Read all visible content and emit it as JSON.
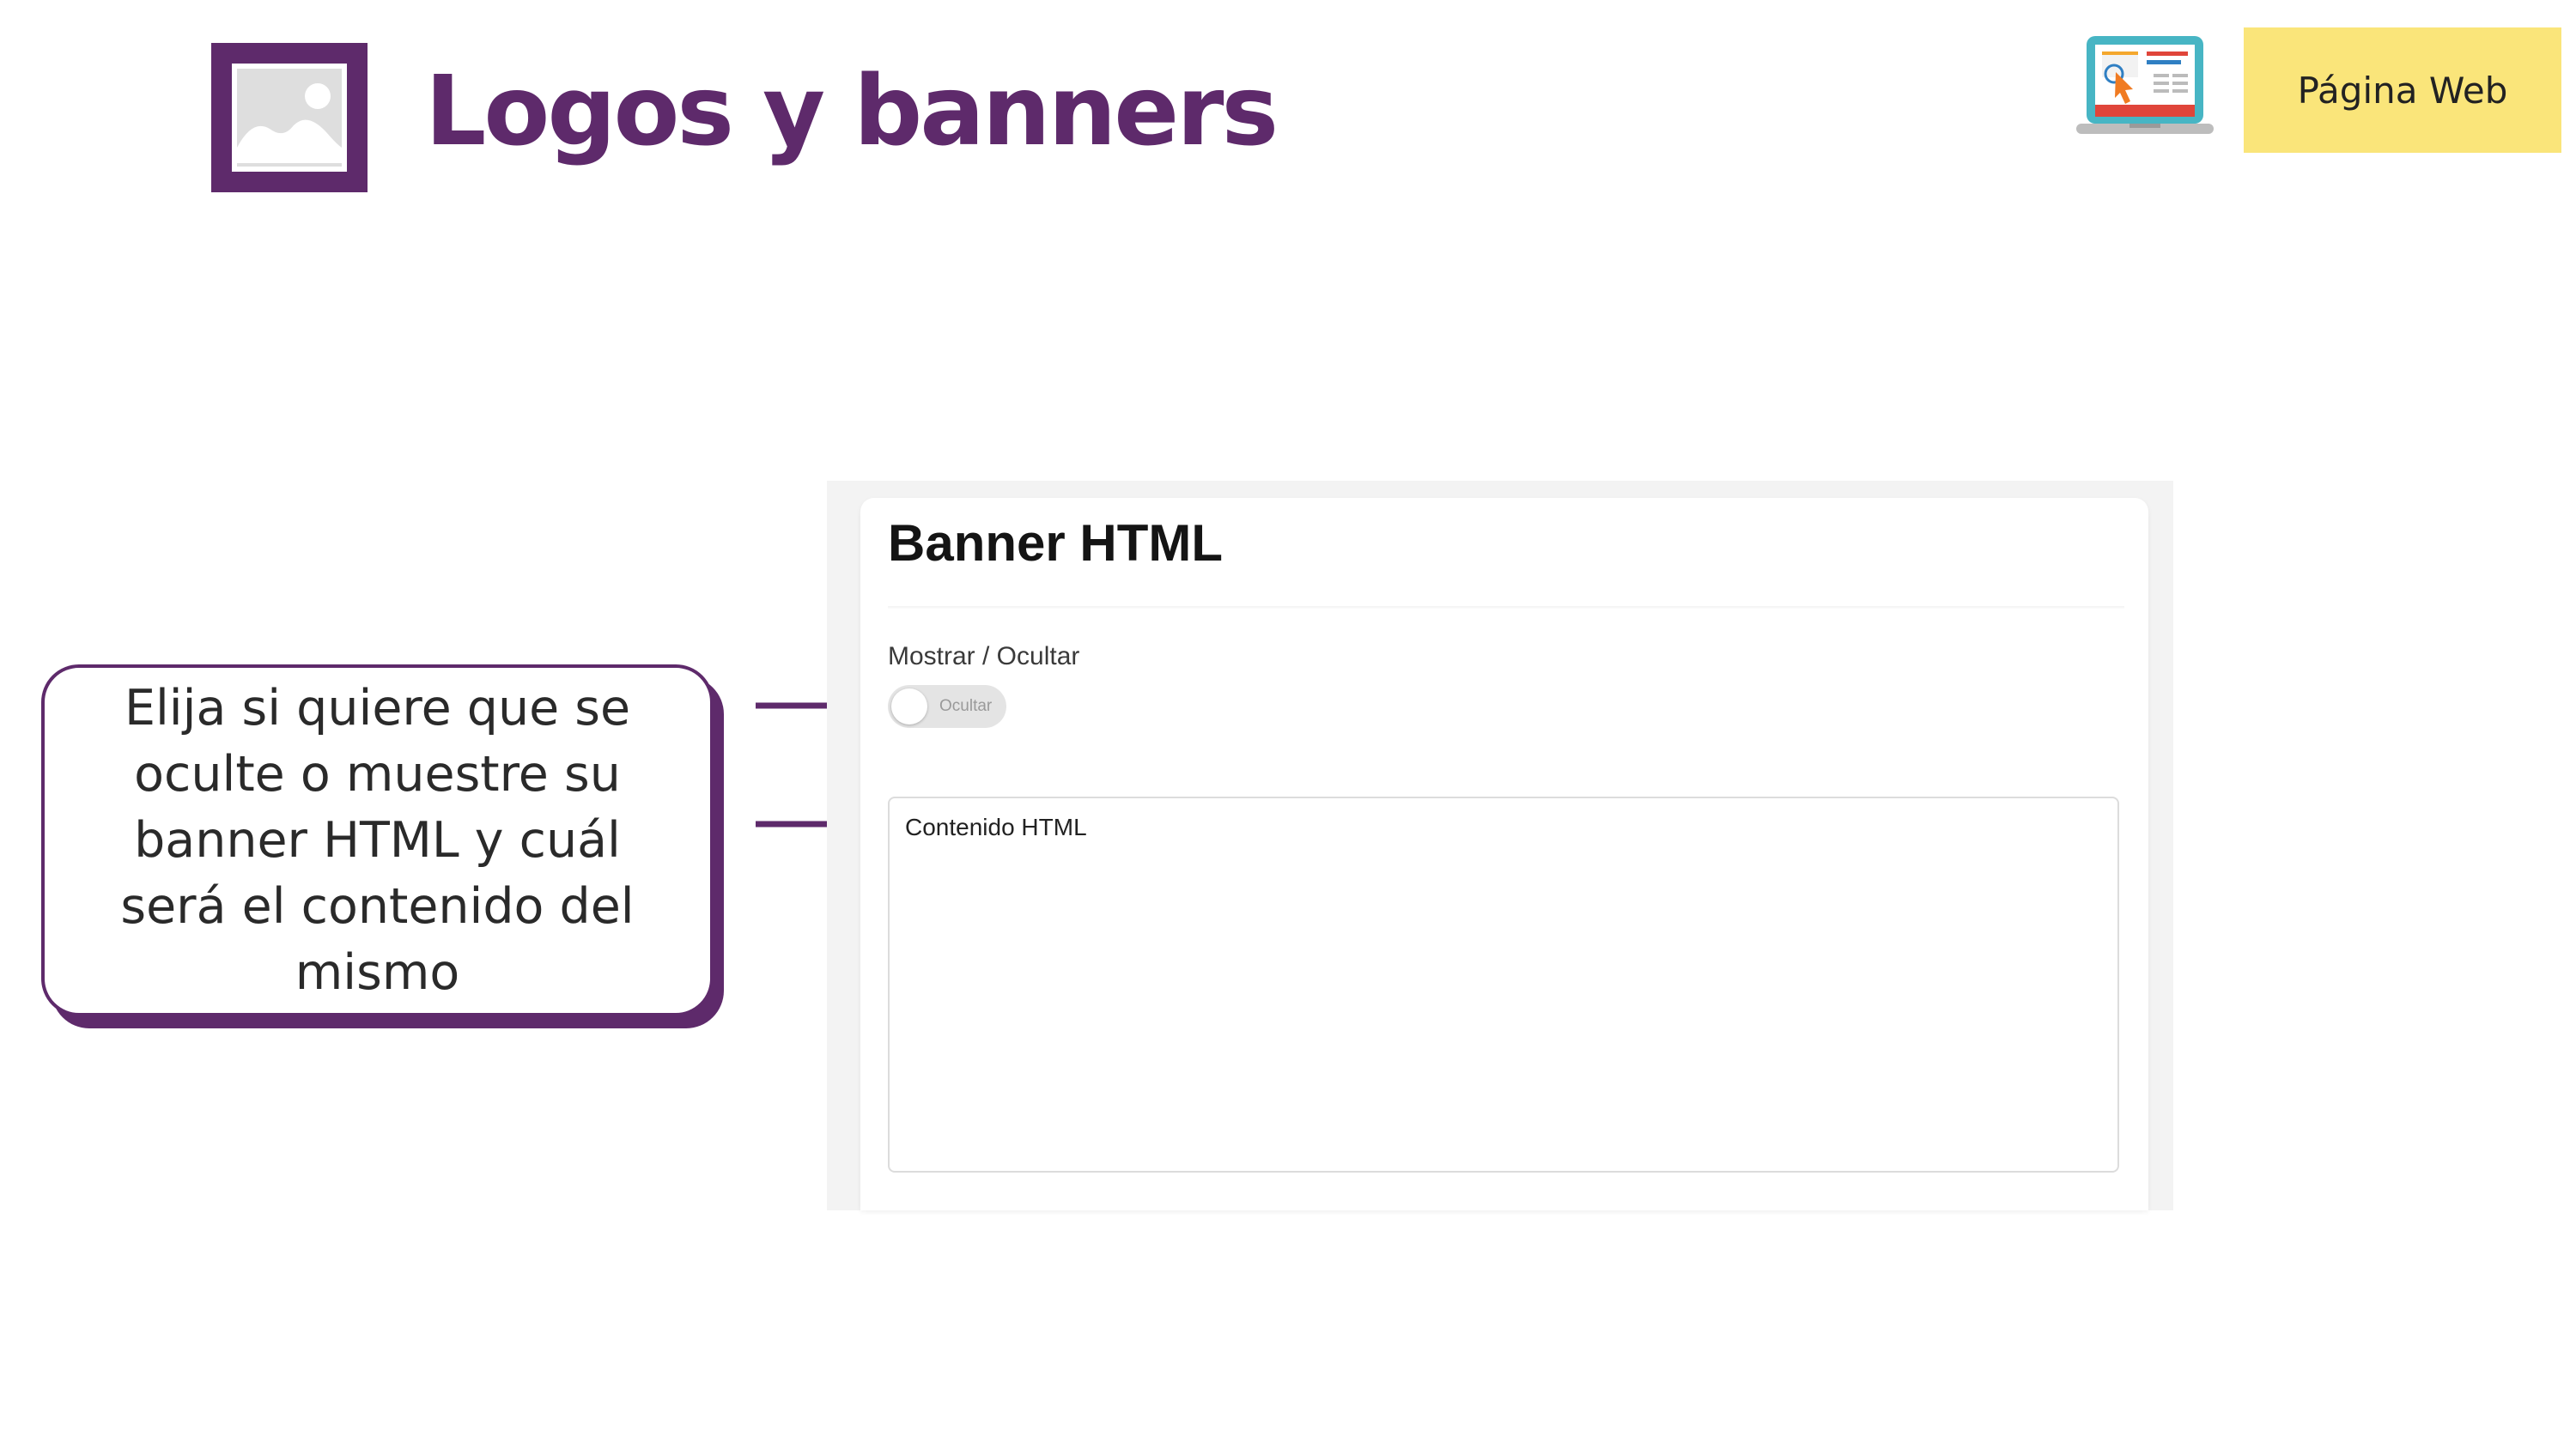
{
  "header": {
    "title": "Logos y banners",
    "web_button_label": "Página Web"
  },
  "callout": {
    "text": "Elija si quiere que se oculte o muestre su banner HTML y cuál será el contenido del mismo"
  },
  "panel": {
    "title": "Banner HTML",
    "toggle_label": "Mostrar / Ocultar",
    "toggle_state_text": "Ocultar",
    "toggle_on": false,
    "textarea_placeholder": "Contenido HTML",
    "textarea_value": ""
  },
  "colors": {
    "brand_purple": "#5e2a6b",
    "button_yellow": "#fae57a"
  },
  "icons": [
    "image-icon",
    "laptop-cursor-icon"
  ]
}
